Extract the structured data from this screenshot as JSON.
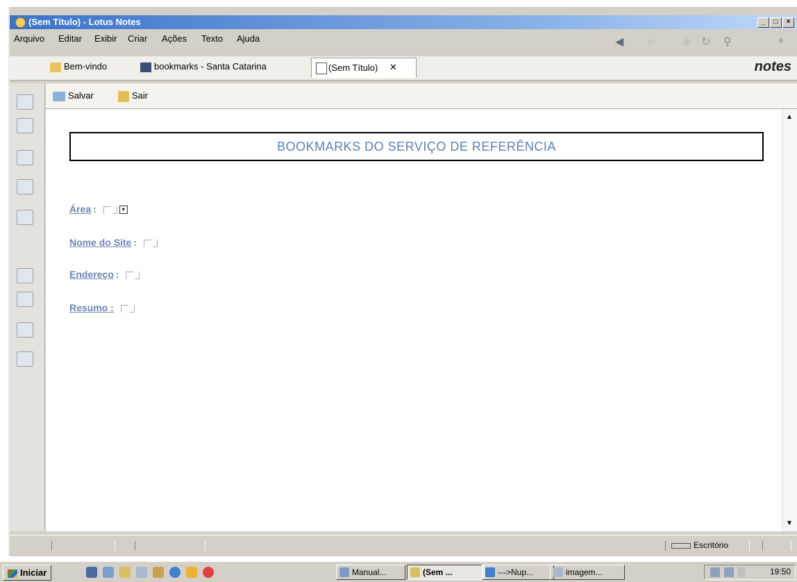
{
  "window": {
    "title": "(Sem Título) - Lotus Notes"
  },
  "menu": {
    "items": [
      "Arquivo",
      "Editar",
      "Exibir",
      "Criar",
      "Ações",
      "Texto",
      "Ajuda"
    ]
  },
  "tabs": [
    {
      "label": "Bem-vindo"
    },
    {
      "label": "bookmarks - Santa Catarina"
    },
    {
      "label": "(Sem Título)",
      "close": "✕"
    }
  ],
  "brand": "notes",
  "actions": {
    "save": "Salvar",
    "exit": "Sair"
  },
  "form": {
    "header": "BOOKMARKS DO SERVIÇO DE REFERÊNCIA",
    "fields": [
      {
        "label": "Área",
        "sep": ":"
      },
      {
        "label": "Nome do Site",
        "sep": ":"
      },
      {
        "label": "Endereço",
        "sep": ":"
      },
      {
        "label": "Resumo :",
        "sep": ""
      }
    ]
  },
  "status": {
    "location": "Escritório"
  },
  "taskbar": {
    "start": "Iniciar",
    "tasks": [
      {
        "label": "Manual..."
      },
      {
        "label": "(Sem ..."
      },
      {
        "label": "--->Nup..."
      },
      {
        "label": "imagem..."
      }
    ],
    "clock": "19:50"
  },
  "colors": {
    "accent": "#5a7fb8",
    "title_bar": "#3a72c8",
    "label": "#6d84b4"
  }
}
